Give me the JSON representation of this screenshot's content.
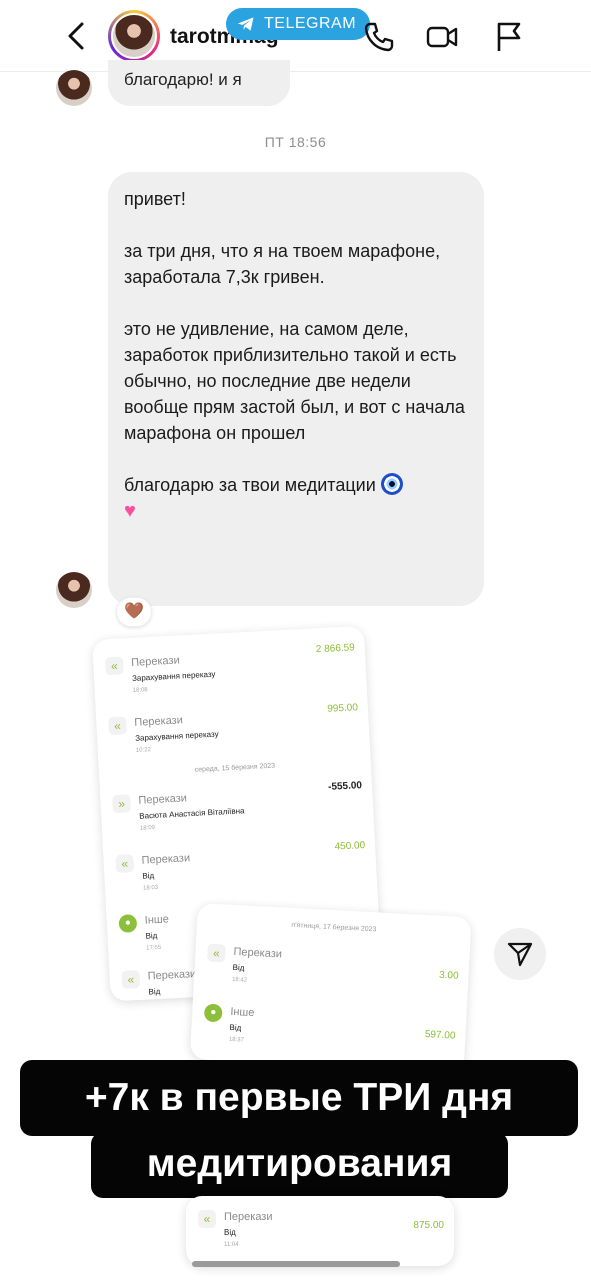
{
  "header": {
    "username": "tarotmmag",
    "overlay_badge": "TELEGRAM",
    "icons": [
      "back-icon",
      "phone-icon",
      "video-icon",
      "flag-icon"
    ]
  },
  "messages": {
    "top_bubble": "благодарю! и я",
    "timestamp": "ПТ 18:56",
    "main_bubble": {
      "p1": "привет!",
      "p2": "за три дня, что я на твоем марафоне, заработала 7,3к гривен.",
      "p3": "это не удивление, на самом деле, заработок приблизительно такой и есть обычно, но последние две недели вообще прям застой был, и вот с начала марафона он прошел",
      "p4": "благодарю за твои медитации"
    },
    "reaction": "🤎"
  },
  "bank_card_1": {
    "rows": [
      {
        "category": "Перекази",
        "desc": "Зарахування переказу",
        "time": "18:08",
        "amount": "2 866.59"
      },
      {
        "category": "Перекази",
        "desc": "Зарахування переказу",
        "time": "10:22",
        "amount": "995.00"
      },
      {
        "category": "Перекази",
        "desc": "Васюта Анастасія Віталіївна",
        "time": "18:09",
        "amount": "-555.00"
      },
      {
        "category": "Перекази",
        "desc": "Від",
        "time": "18:03",
        "amount": "450.00"
      },
      {
        "category": "Інше",
        "desc": "Від",
        "time": "17:55",
        "amount": ""
      },
      {
        "category": "Перекази",
        "desc": "Від",
        "time": "",
        "amount": ""
      }
    ],
    "date_separator": "середа, 15 березня 2023"
  },
  "bank_card_2": {
    "date_separator": "п'ятниця, 17 березня 2023",
    "rows": [
      {
        "category": "Перекази",
        "desc": "Від",
        "time": "18:42",
        "amount": "3.00"
      },
      {
        "category": "Інше",
        "desc": "Від",
        "time": "18:37",
        "amount": "597.00"
      }
    ]
  },
  "bank_card_3": {
    "rows": [
      {
        "category": "Перекази",
        "desc": "Від",
        "time": "11:04",
        "amount": "875.00"
      }
    ]
  },
  "caption": {
    "line1": "+7к в первые ТРИ дня",
    "line2": "медитирования"
  },
  "colors": {
    "telegram_blue": "#2aa3e0",
    "bubble_gray": "#efefef",
    "bank_green": "#8cbf3a",
    "caption_bg": "#050505"
  }
}
